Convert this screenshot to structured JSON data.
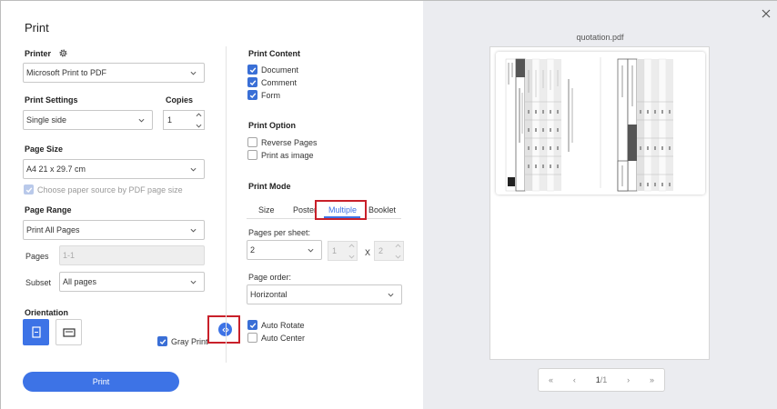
{
  "dialog": {
    "title": "Print"
  },
  "printer": {
    "label": "Printer",
    "value": "Microsoft Print to PDF"
  },
  "print_settings": {
    "label": "Print Settings",
    "value": "Single side"
  },
  "copies": {
    "label": "Copies",
    "value": "1"
  },
  "page_size": {
    "label": "Page Size",
    "value": "A4 21 x 29.7 cm",
    "paper_source_label": "Choose paper source by PDF page size",
    "paper_source_checked": true
  },
  "page_range": {
    "label": "Page Range",
    "value": "Print All Pages",
    "pages_label": "Pages",
    "pages_placeholder": "1-1",
    "subset_label": "Subset",
    "subset_value": "All pages"
  },
  "orientation": {
    "label": "Orientation",
    "selected": "portrait"
  },
  "gray_print": {
    "label": "Gray Print",
    "checked": true
  },
  "print_button": {
    "label": "Print"
  },
  "print_content": {
    "label": "Print Content",
    "items": [
      {
        "label": "Document",
        "checked": true
      },
      {
        "label": "Comment",
        "checked": true
      },
      {
        "label": "Form",
        "checked": true
      }
    ]
  },
  "print_option": {
    "label": "Print Option",
    "items": [
      {
        "label": "Reverse Pages",
        "checked": false
      },
      {
        "label": "Print as image",
        "checked": false
      }
    ]
  },
  "print_mode": {
    "label": "Print Mode",
    "tabs": [
      "Size",
      "Poster",
      "Multiple",
      "Booklet"
    ],
    "active_tab": "Multiple"
  },
  "pages_per_sheet": {
    "label": "Pages per sheet:",
    "value": "2",
    "cols": "1",
    "times": "X",
    "rows": "2"
  },
  "page_order": {
    "label": "Page order:",
    "value": "Horizontal"
  },
  "auto_options": [
    {
      "label": "Auto Rotate",
      "checked": true
    },
    {
      "label": "Auto Center",
      "checked": false
    }
  ],
  "preview": {
    "filename": "quotation.pdf",
    "page_current": "1",
    "page_total": "/1"
  },
  "colors": {
    "accent": "#3d73e6",
    "highlight": "#c8202a",
    "preview_bg": "#ebecf0"
  }
}
